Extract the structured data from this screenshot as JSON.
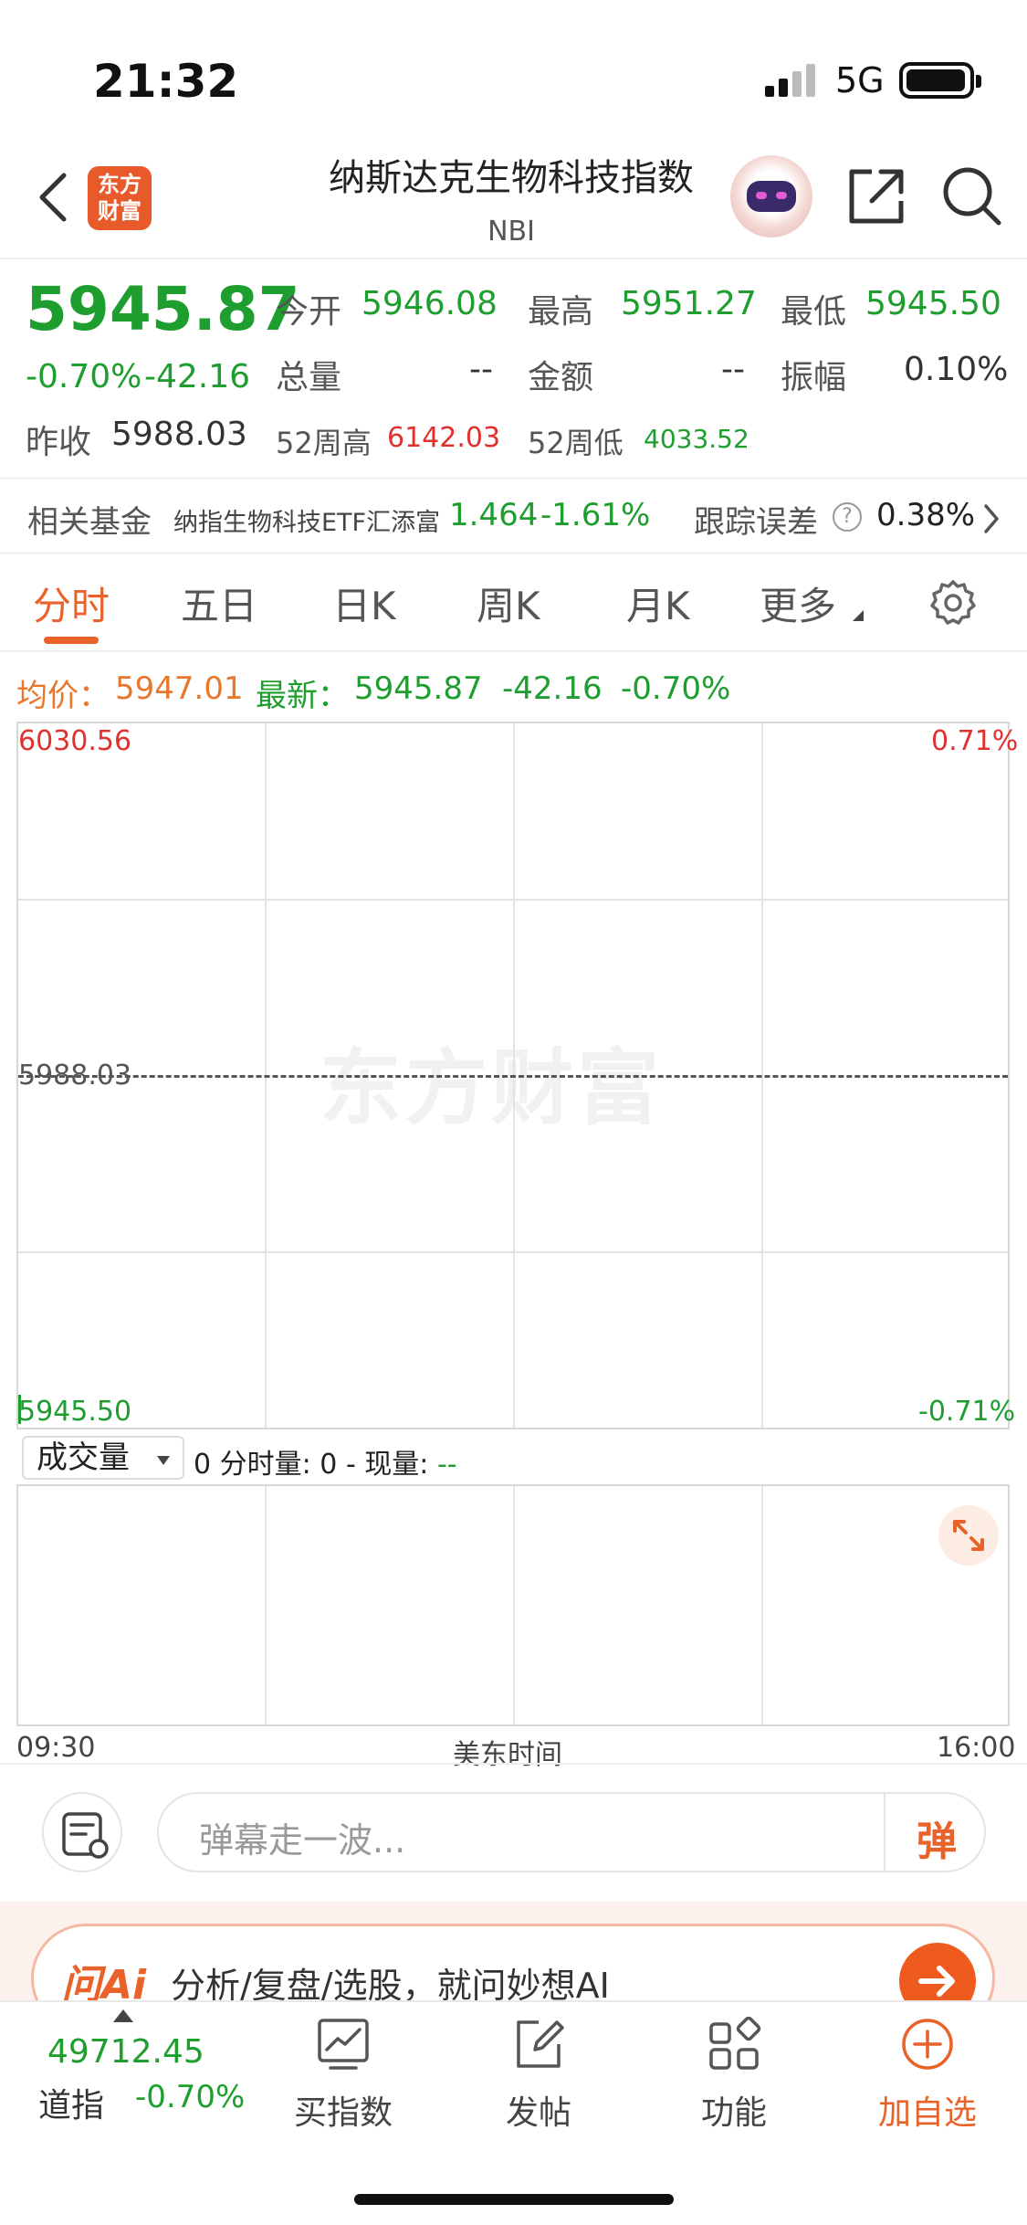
{
  "status": {
    "time": "21:32",
    "network": "5G"
  },
  "header": {
    "logo_text": "东方财富",
    "title": "纳斯达克生物科技指数",
    "subtitle": "NBI"
  },
  "quote": {
    "price": "5945.87",
    "change_pct": "-0.70%",
    "change": "-42.16",
    "open_label": "今开",
    "open": "5946.08",
    "high_label": "最高",
    "high": "5951.27",
    "low_label": "最低",
    "low": "5945.50",
    "volume_label": "总量",
    "volume": "--",
    "amount_label": "金额",
    "amount": "--",
    "amplitude_label": "振幅",
    "amplitude": "0.10%",
    "prev_close_label": "昨收",
    "prev_close": "5988.03",
    "week52_high_label": "52周高",
    "week52_high": "6142.03",
    "week52_low_label": "52周低",
    "week52_low": "4033.52"
  },
  "fund": {
    "label": "相关基金",
    "name": "纳指生物科技ETF汇添富",
    "price": "1.464",
    "change": "-1.61%",
    "tracking_label": "跟踪误差",
    "help": "?",
    "tracking": "0.38%"
  },
  "tabs": [
    "分时",
    "五日",
    "日K",
    "周K",
    "月K",
    "更多"
  ],
  "chart_info": {
    "avg_label": "均价：",
    "avg": "5947.01",
    "last_label": "最新：",
    "last": "5945.87",
    "last_change": "-42.16",
    "last_pct": "-0.70%"
  },
  "chart": {
    "y_top": "6030.56",
    "y_mid": "5988.03",
    "y_bottom": "5945.50",
    "pct_top": "0.71%",
    "pct_bottom": "-0.71%",
    "watermark": "东方财富"
  },
  "volume": {
    "select": "成交量",
    "info_prefix": "0",
    "info_label1": "分时量:",
    "info_val1": "0",
    "info_label2": "- 现量:",
    "info_val2": "--"
  },
  "time_axis": {
    "start": "09:30",
    "mid": "美东时间",
    "end": "16:00"
  },
  "danmu": {
    "placeholder": "弹幕走一波...",
    "button": "弹"
  },
  "ai": {
    "logo": "问Ai",
    "text": "分析/复盘/选股，就问妙想AI"
  },
  "bottom_nav": {
    "index_value": "49712.45",
    "index_name": "道指",
    "index_change": "-0.70%",
    "items": [
      "买指数",
      "发帖",
      "功能",
      "加自选"
    ]
  }
}
